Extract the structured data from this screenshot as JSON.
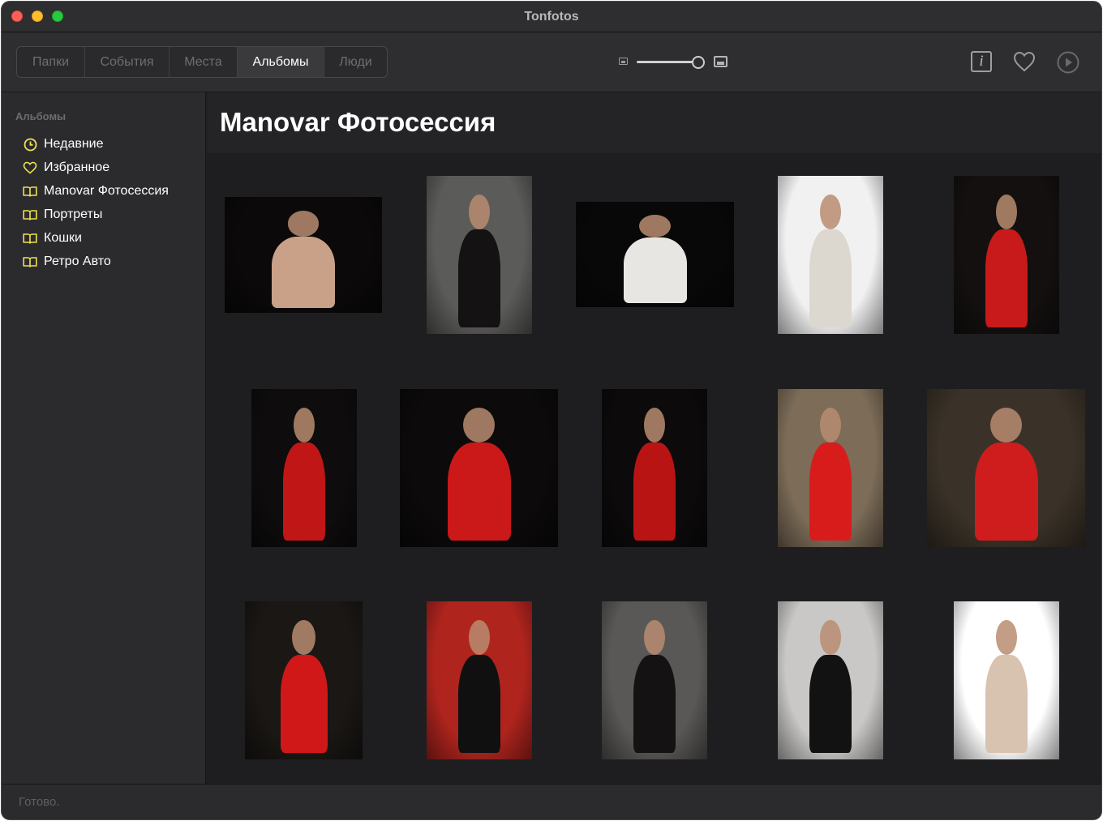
{
  "window": {
    "title": "Tonfotos"
  },
  "toolbar": {
    "tabs": [
      {
        "label": "Папки",
        "active": false
      },
      {
        "label": "События",
        "active": false
      },
      {
        "label": "Места",
        "active": false
      },
      {
        "label": "Альбомы",
        "active": true
      },
      {
        "label": "Люди",
        "active": false
      }
    ],
    "zoom_level": 1.0,
    "info_label": "i"
  },
  "sidebar": {
    "heading": "Альбомы",
    "items": [
      {
        "label": "Недавние",
        "icon": "clock-icon",
        "icon_color": "#f0e050"
      },
      {
        "label": "Избранное",
        "icon": "heart-icon",
        "icon_color": "#f0e050"
      },
      {
        "label": "Manovar Фотосессия",
        "icon": "book-icon",
        "icon_color": "#f0e050"
      },
      {
        "label": "Портреты",
        "icon": "book-icon",
        "icon_color": "#f0e050"
      },
      {
        "label": "Кошки",
        "icon": "book-icon",
        "icon_color": "#f0e050"
      },
      {
        "label": "Ретро Авто",
        "icon": "book-icon",
        "icon_color": "#f0e050"
      }
    ]
  },
  "content": {
    "album_title": "Manovar Фотосессия",
    "photos": [
      {
        "bg": "#0b0909",
        "accent": "#c9a088"
      },
      {
        "bg": "#5b5b59",
        "accent": "#141212"
      },
      {
        "bg": "#080808",
        "accent": "#e8e6e2"
      },
      {
        "bg": "#f1f1f1",
        "accent": "#dcd8d0"
      },
      {
        "bg": "#141010",
        "accent": "#c81a1a"
      },
      {
        "bg": "#0e0c0c",
        "accent": "#c11616"
      },
      {
        "bg": "#0c0a0a",
        "accent": "#cb1818"
      },
      {
        "bg": "#0c0a0a",
        "accent": "#b91414"
      },
      {
        "bg": "#7c6c58",
        "accent": "#d81c1c"
      },
      {
        "bg": "#3a3228",
        "accent": "#cf1c1c"
      },
      {
        "bg": "#1a1714",
        "accent": "#d01818"
      },
      {
        "bg": "#b0241e",
        "accent": "#101010"
      },
      {
        "bg": "#5a5856",
        "accent": "#141212"
      },
      {
        "bg": "#c9c8c6",
        "accent": "#121212"
      },
      {
        "bg": "#ffffff",
        "accent": "#d8c2b0"
      }
    ]
  },
  "statusbar": {
    "text": "Готово."
  }
}
